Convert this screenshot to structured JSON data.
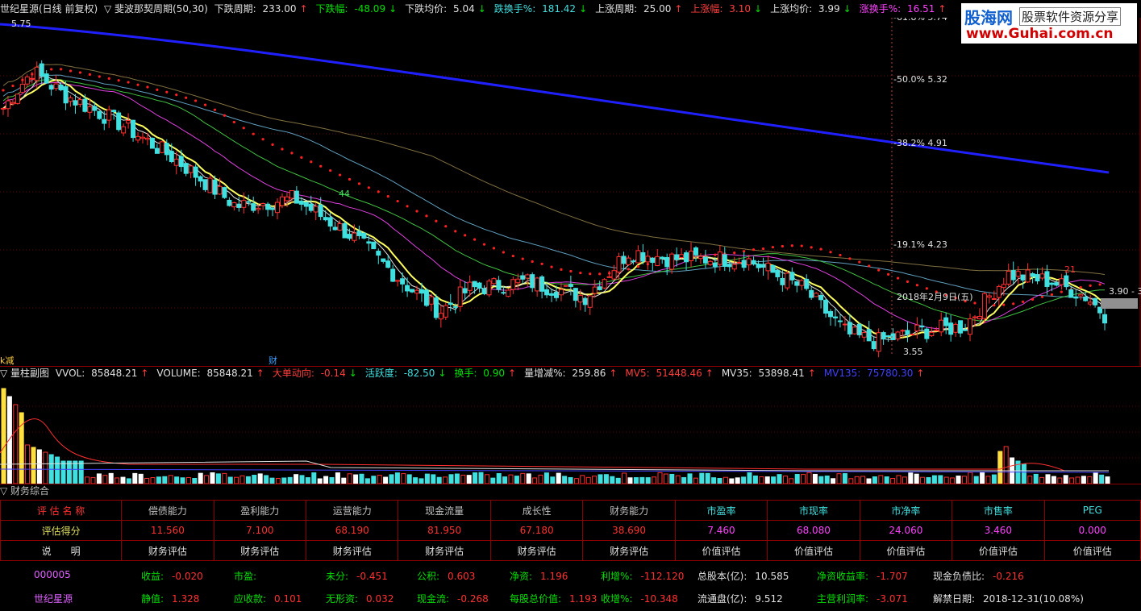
{
  "header": {
    "title": "世纪星源(日线 前复权)",
    "indicator_name": "▽ 斐波那契周期(50,30)",
    "items": [
      {
        "label": "下跌周期:",
        "value": "233.00",
        "arrow": "↑",
        "color": "#e0e0e0"
      },
      {
        "label": "下跌幅:",
        "value": "-48.09",
        "arrow": "↓",
        "color": "#00e000"
      },
      {
        "label": "下跌均价:",
        "value": "5.04",
        "arrow": "↓",
        "color": "#e0e0e0"
      },
      {
        "label": "跌换手%:",
        "value": "181.42",
        "arrow": "↓",
        "color": "#40e0e0"
      },
      {
        "label": "上涨周期:",
        "value": "25.00",
        "arrow": "↑",
        "color": "#e0e0e0"
      },
      {
        "label": "上涨幅:",
        "value": "3.10",
        "arrow": "↓",
        "color": "#ff3c3c"
      },
      {
        "label": "上涨均价:",
        "value": "3.99",
        "arrow": "↓",
        "color": "#e0e0e0"
      },
      {
        "label": "涨换手%:",
        "value": "16.51",
        "arrow": "↑",
        "color": "#ff40ff"
      }
    ]
  },
  "logo": {
    "line1": "股海网",
    "line1b": "股票软件资源分享",
    "line2": "www.Guhai.com.cn"
  },
  "price_chart": {
    "fib_labels": [
      {
        "text": "61.8% 5.74",
        "price": 5.74
      },
      {
        "text": "50.0% 5.32",
        "price": 5.32
      },
      {
        "text": "38.2% 4.91",
        "price": 4.91
      },
      {
        "text": "19.1% 4.23",
        "price": 4.23
      }
    ],
    "high_label": "5.75",
    "low_label": "3.55",
    "date_label": "2018年2月9日(五)",
    "right_label": "3.90 - 3.",
    "mark_44": "44",
    "mark_21": "21",
    "corner_label": "k减",
    "cai_label": "财"
  },
  "volume_header": {
    "title": "▽ 量柱副图",
    "items": [
      {
        "label": "VVOL:",
        "value": "85848.21",
        "arrow": "↑",
        "color": "#e0e0e0"
      },
      {
        "label": "VOLUME:",
        "value": "85848.21",
        "arrow": "↑",
        "color": "#e0e0e0"
      },
      {
        "label": "大单动向:",
        "value": "-0.14",
        "arrow": "↓",
        "color": "#ff3c3c"
      },
      {
        "label": "活跃度:",
        "value": "-82.50",
        "arrow": "↓",
        "color": "#40e0e0"
      },
      {
        "label": "换手:",
        "value": "0.90",
        "arrow": "↑",
        "color": "#00e000"
      },
      {
        "label": "量增减%:",
        "value": "259.86",
        "arrow": "↑",
        "color": "#e0e0e0"
      },
      {
        "label": "MV5:",
        "value": "51448.46",
        "arrow": "↑",
        "color": "#ff3c3c"
      },
      {
        "label": "MV35:",
        "value": "53898.41",
        "arrow": "↑",
        "color": "#e0e0e0"
      },
      {
        "label": "MV135:",
        "value": "75780.30",
        "arrow": "↑",
        "color": "#4040ff"
      }
    ]
  },
  "financial": {
    "title": "▽ 财务综合",
    "header_row": [
      "评 估 名 称",
      "偿债能力",
      "盈利能力",
      "运营能力",
      "现金流量",
      "成长性",
      "财务能力",
      "市盈率",
      "市现率",
      "市净率",
      "市售率",
      "PEG"
    ],
    "score_row": [
      "评估得分",
      "11.560",
      "7.100",
      "68.190",
      "81.950",
      "67.180",
      "38.690",
      "7.460",
      "68.080",
      "24.060",
      "3.460",
      "0.000"
    ],
    "desc_row": [
      "说　　明",
      "财务评估",
      "财务评估",
      "财务评估",
      "财务评估",
      "财务评估",
      "财务评估",
      "价值评估",
      "价值评估",
      "价值评估",
      "价值评估",
      "价值评估"
    ],
    "info_row1": [
      {
        "k": "000005",
        "v": ""
      },
      {
        "k": "收益:",
        "v": "-0.020"
      },
      {
        "k": "市盈:",
        "v": ""
      },
      {
        "k": "未分:",
        "v": "-0.451"
      },
      {
        "k": "公积:",
        "v": "0.603"
      },
      {
        "k": "净资:",
        "v": "1.196"
      },
      {
        "k": "利增%:",
        "v": "-112.120"
      },
      {
        "k": "总股本(亿):",
        "v": "10.585"
      },
      {
        "k": "净资收益率:",
        "v": "-1.707"
      },
      {
        "k": "现金负债比:",
        "v": "-0.216"
      }
    ],
    "info_row2": [
      {
        "k": "世纪星源",
        "v": ""
      },
      {
        "k": "静值:",
        "v": "1.328"
      },
      {
        "k": "应收款:",
        "v": "0.101"
      },
      {
        "k": "无形资:",
        "v": "0.032"
      },
      {
        "k": "现金流:",
        "v": "-0.268"
      },
      {
        "k": "每股总价值:",
        "v": "1.193"
      },
      {
        "k": "收增%:",
        "v": "-10.348"
      },
      {
        "k": "流通盘(亿):",
        "v": "9.512"
      },
      {
        "k": "主营利润率:",
        "v": "-3.071"
      },
      {
        "k": "解禁日期:",
        "v": "2018-12-31(10.08%)"
      }
    ]
  }
}
